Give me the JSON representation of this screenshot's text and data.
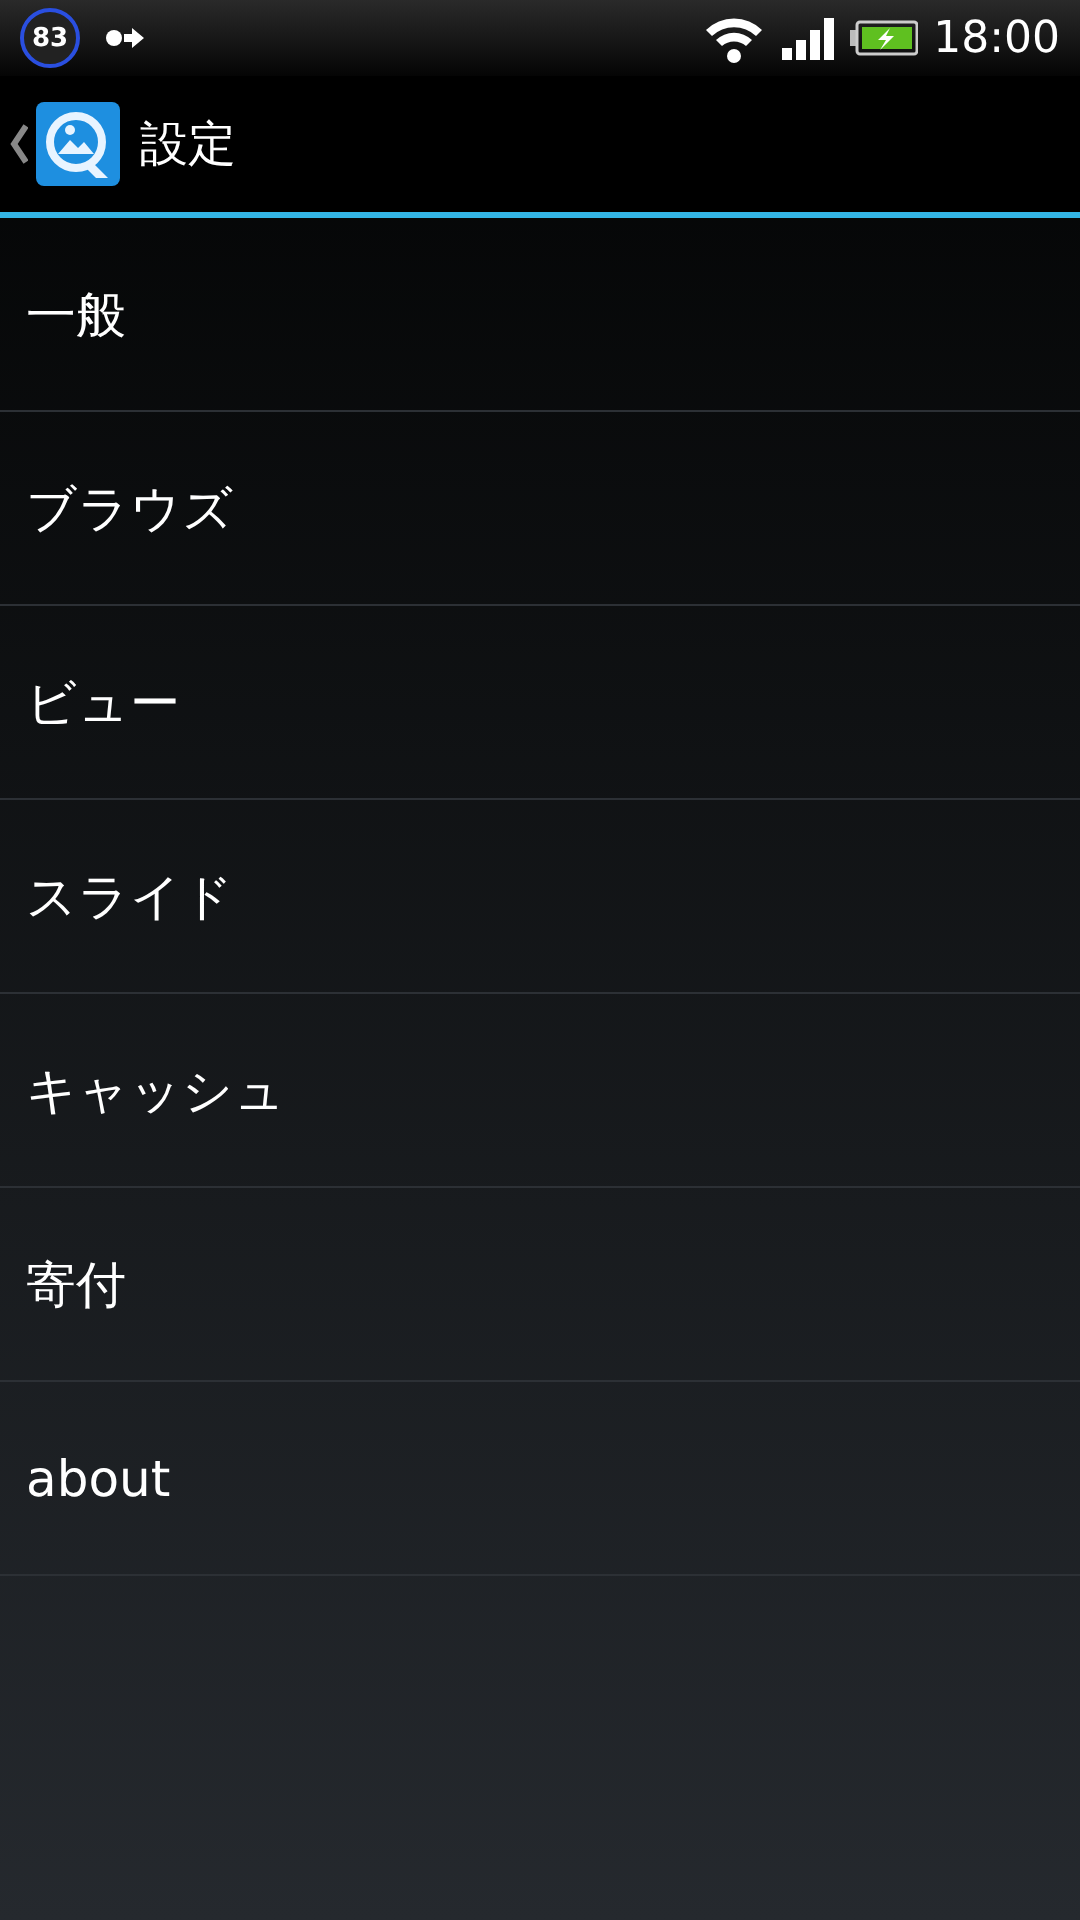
{
  "status_bar": {
    "badge": "83",
    "time": "18:00"
  },
  "action_bar": {
    "title": "設定"
  },
  "items": [
    {
      "label": "一般"
    },
    {
      "label": "ブラウズ"
    },
    {
      "label": "ビュー"
    },
    {
      "label": "スライド"
    },
    {
      "label": "キャッシュ"
    },
    {
      "label": "寄付"
    },
    {
      "label": "about"
    }
  ]
}
